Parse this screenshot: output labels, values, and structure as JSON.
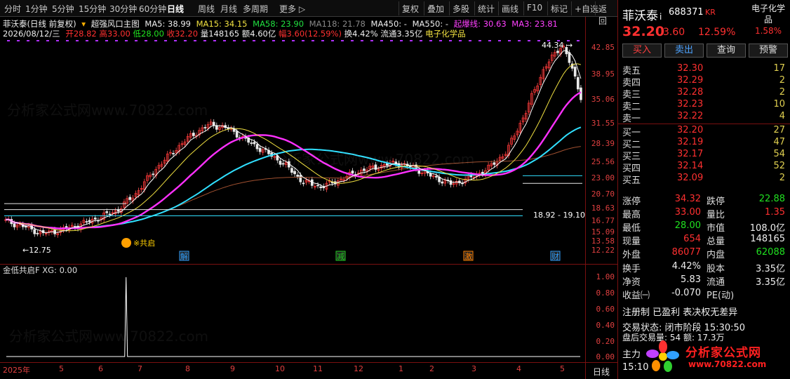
{
  "toolbar": {
    "periods": [
      "分时",
      "1分钟",
      "5分钟",
      "15分钟",
      "30分钟",
      "60分钟",
      "日线",
      "周线",
      "月线",
      "多周期",
      "更多 ▷"
    ],
    "active_period": "日线",
    "buttons": [
      "复权",
      "叠加",
      "多股",
      "统计",
      "画线",
      "F10",
      "标记",
      "+自选",
      "返回"
    ]
  },
  "info": {
    "title": "菲沃泰(日线 前复权)",
    "indicator_name": "超强风口主图",
    "ma5": "MA5: 38.99",
    "ma15": "MA15: 34.15",
    "ma58": "MA58: 23.90",
    "ma118": "MA118: 21.78",
    "ma450": "MA450: -",
    "ma550": "MA550: -",
    "qibao": "起爆线: 30.63",
    "ma3": "MA3: 23.81",
    "date": "2026/08/12/三",
    "open": "开28.82",
    "high": "高33.00",
    "low": "低28.00",
    "close": "收32.20",
    "volume": "量148165",
    "amount": "额4.60亿",
    "amplitude": "幅3.60(12.59%)",
    "turnover": "换4.42%",
    "float": "流通3.35亿",
    "sector": "电子化学品"
  },
  "price_axis": [
    "42.85",
    "38.95",
    "35.06",
    "31.55",
    "28.39",
    "25.56",
    "23.00",
    "20.70",
    "18.63",
    "16.77",
    "15.09",
    "13.58",
    "12.22"
  ],
  "annotations": {
    "high_label": "44.34",
    "low_label": "12.75",
    "range_label": "18.92 - 19.10",
    "signal_label": "共启",
    "events": [
      "解",
      "减",
      "激",
      "财"
    ]
  },
  "indicator": {
    "title": "金低共启F  XG: 0.00",
    "axis": [
      "1.00",
      "0.80",
      "0.60",
      "0.40",
      "0.20",
      "0.00"
    ]
  },
  "date_axis": [
    "2025年",
    "5",
    "6",
    "7",
    "8",
    "9",
    "10",
    "11",
    "12",
    "1",
    "2",
    "3",
    "4",
    "5"
  ],
  "period_tab": "日线",
  "side": {
    "name": "菲沃泰",
    "badge": "i",
    "code": "688371",
    "market": "KR",
    "sector": "电子化学品",
    "sector_pct": "1.58%",
    "price": "32.20",
    "change": "3.60",
    "change_pct": "12.59%",
    "buttons": [
      "买入",
      "卖出",
      "查询",
      "预警"
    ],
    "asks": [
      {
        "label": "卖五",
        "price": "32.30",
        "vol": "17"
      },
      {
        "label": "卖四",
        "price": "32.29",
        "vol": "2"
      },
      {
        "label": "卖三",
        "price": "32.28",
        "vol": "2"
      },
      {
        "label": "卖二",
        "price": "32.23",
        "vol": "10"
      },
      {
        "label": "卖一",
        "price": "32.22",
        "vol": "4"
      }
    ],
    "bids": [
      {
        "label": "买一",
        "price": "32.20",
        "vol": "27"
      },
      {
        "label": "买二",
        "price": "32.19",
        "vol": "47"
      },
      {
        "label": "买三",
        "price": "32.17",
        "vol": "54"
      },
      {
        "label": "买四",
        "price": "32.14",
        "vol": "52"
      },
      {
        "label": "买五",
        "price": "32.09",
        "vol": "2"
      }
    ],
    "stats1": [
      {
        "l": "涨停",
        "lv": "34.32",
        "r": "跌停",
        "rv": "22.88"
      },
      {
        "l": "最高",
        "lv": "33.00",
        "r": "量比",
        "rv": "1.35"
      },
      {
        "l": "最低",
        "lv": "28.00",
        "r": "市值",
        "rv": "108.0亿"
      },
      {
        "l": "现量",
        "lv": "654",
        "r": "总量",
        "rv": "148165"
      },
      {
        "l": "外盘",
        "lv": "86077",
        "r": "内盘",
        "rv": "62088"
      }
    ],
    "stats2": [
      {
        "l": "换手",
        "lv": "4.42%",
        "r": "股本",
        "rv": "3.35亿"
      },
      {
        "l": "净资",
        "lv": "5.83",
        "r": "流通",
        "rv": "3.35亿"
      },
      {
        "l": "收益㈠",
        "lv": "-0.070",
        "r": "PE(动)",
        "rv": ""
      }
    ],
    "notice": "注册制 已盈利 表决权无差异",
    "state": "交易状态: 闭市阶段  15:30:50",
    "after": "盘后交易量: 54  额: 17.3万",
    "zhuli": "主力",
    "clock": "15:10",
    "logo_title": "分析家公式网",
    "logo_url": "www.70822.com"
  },
  "chart_data": {
    "type": "candlestick",
    "title": "菲沃泰(日线 前复权)",
    "y_scale": "log",
    "ylim": [
      12.0,
      46.0
    ],
    "x_months": [
      "2025-04",
      "2025-05",
      "2025-06",
      "2025-07",
      "2025-08",
      "2025-09",
      "2025-10",
      "2025-11",
      "2025-12",
      "2026-01",
      "2026-02",
      "2026-03",
      "2026-04",
      "2026-05",
      "2026-08"
    ],
    "close_path_approx": [
      15.1,
      14.6,
      14.0,
      14.3,
      14.8,
      15.4,
      16.1,
      17.8,
      20.5,
      23.0,
      25.4,
      27.2,
      26.5,
      24.6,
      23.0,
      21.4,
      19.2,
      18.6,
      19.4,
      20.4,
      21.0,
      21.5,
      20.9,
      19.8,
      18.9,
      19.6,
      20.8,
      23.0,
      29.0,
      38.0,
      44.3,
      32.2
    ],
    "series": [
      {
        "name": "MA5",
        "value": 38.99
      },
      {
        "name": "MA15",
        "value": 34.15
      },
      {
        "name": "MA58",
        "value": 23.9
      },
      {
        "name": "MA118",
        "value": 21.78
      },
      {
        "name": "起爆线",
        "value": 30.63
      },
      {
        "name": "MA3",
        "value": 23.81
      }
    ],
    "indicator": {
      "name": "金低共启F",
      "xg": 0.0,
      "signal_month": "2025-07",
      "signal_value": 1.0
    }
  }
}
